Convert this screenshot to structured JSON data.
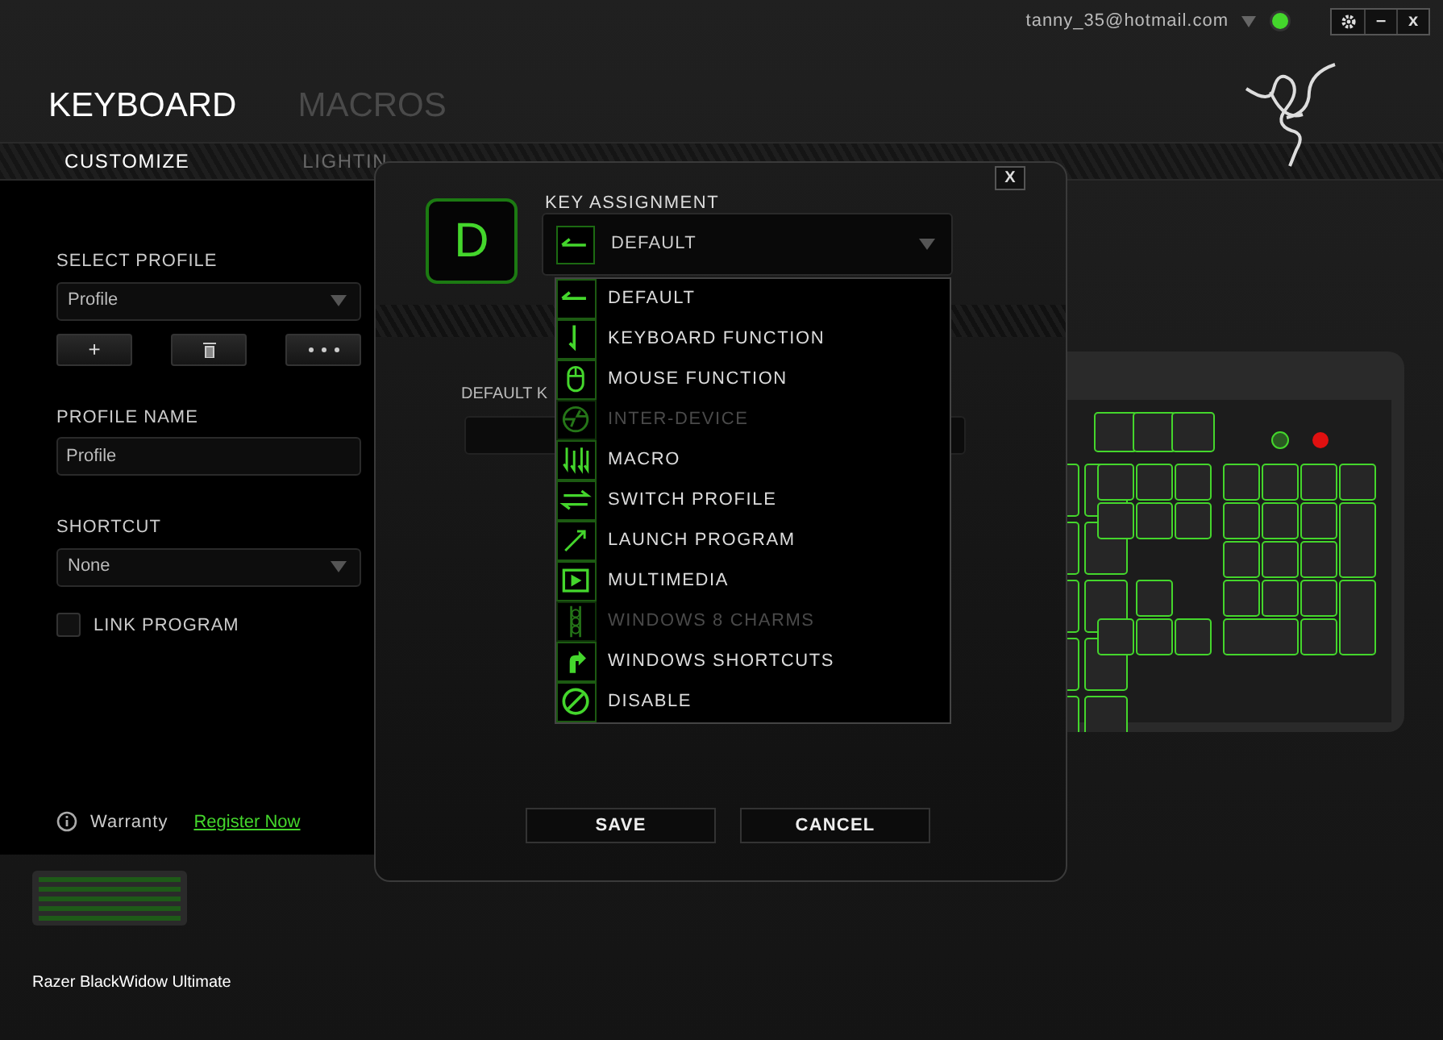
{
  "account": {
    "email": "tanny_35@hotmail.com",
    "online": true
  },
  "window_controls": {
    "minimize": "–",
    "close": "x"
  },
  "main_tabs": [
    {
      "label": "KEYBOARD",
      "selected": true
    },
    {
      "label": "MACROS",
      "selected": false
    }
  ],
  "sub_tabs": [
    {
      "label": "CUSTOMIZE",
      "selected": true
    },
    {
      "label": "LIGHTIN",
      "selected": false
    }
  ],
  "sidebar": {
    "select_profile": {
      "label": "SELECT PROFILE",
      "value": "Profile"
    },
    "add_button": "+",
    "profile_name": {
      "label": "PROFILE NAME",
      "value": "Profile"
    },
    "shortcut": {
      "label": "SHORTCUT",
      "value": "None"
    },
    "link_program": {
      "label": "LINK PROGRAM",
      "checked": false
    },
    "warranty": {
      "label": "Warranty",
      "link": "Register Now"
    }
  },
  "device": {
    "name": "Razer BlackWidow Ultimate"
  },
  "dialog": {
    "close": "X",
    "key": "D",
    "title": "KEY ASSIGNMENT",
    "value": "DEFAULT",
    "field_label": "DEFAULT K",
    "options": [
      {
        "label": "DEFAULT",
        "disabled": false
      },
      {
        "label": "KEYBOARD FUNCTION",
        "disabled": false
      },
      {
        "label": "MOUSE FUNCTION",
        "disabled": false
      },
      {
        "label": "INTER-DEVICE",
        "disabled": true
      },
      {
        "label": "MACRO",
        "disabled": false
      },
      {
        "label": "SWITCH PROFILE",
        "disabled": false
      },
      {
        "label": "LAUNCH PROGRAM",
        "disabled": false
      },
      {
        "label": "MULTIMEDIA",
        "disabled": false
      },
      {
        "label": "WINDOWS 8 CHARMS",
        "disabled": true
      },
      {
        "label": "WINDOWS SHORTCUTS",
        "disabled": false
      },
      {
        "label": "DISABLE",
        "disabled": false
      }
    ],
    "buttons": [
      "SAVE",
      "CANCEL"
    ]
  }
}
